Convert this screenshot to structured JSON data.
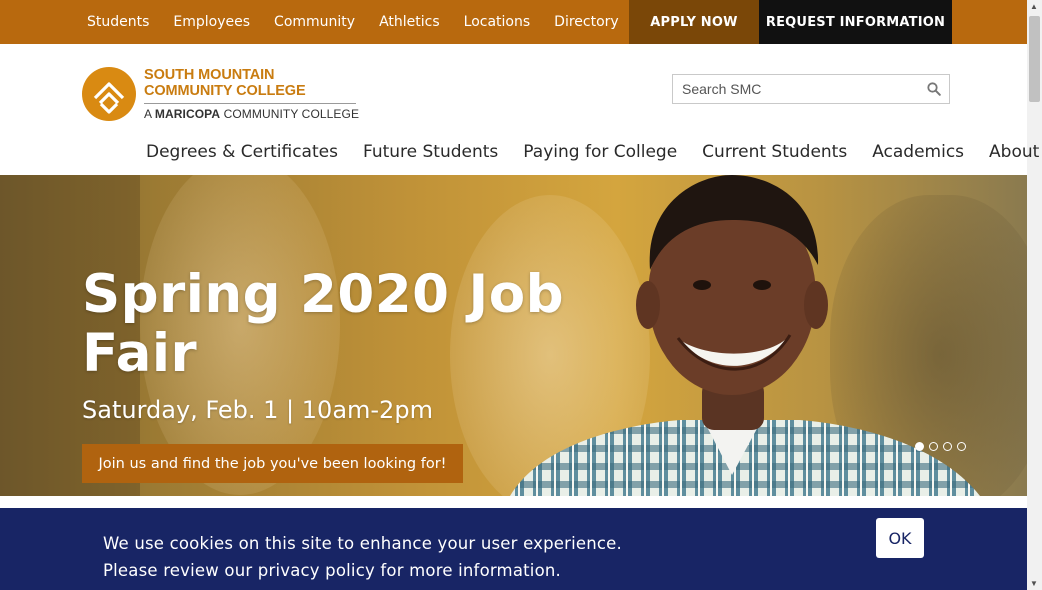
{
  "utility_nav": {
    "items": [
      "Students",
      "Employees",
      "Community",
      "Athletics",
      "Locations",
      "Directory"
    ],
    "apply_label": "APPLY NOW",
    "request_label": "REQUEST INFORMATION"
  },
  "logo": {
    "line1": "SOUTH MOUNTAIN",
    "line2": "COMMUNITY COLLEGE",
    "sub_prefix": "A",
    "sub_bold": "MARICOPA",
    "sub_rest": "COMMUNITY COLLEGE"
  },
  "search": {
    "placeholder": "Search SMC",
    "icon": "search-icon"
  },
  "main_nav": {
    "items": [
      "Degrees & Certificates",
      "Future Students",
      "Paying for College",
      "Current Students",
      "Academics",
      "About"
    ]
  },
  "hero": {
    "title": "Spring 2020 Job Fair",
    "date": "Saturday, Feb. 1 | 10am-2pm",
    "cta": "Join us and find the job you've been looking for!",
    "slide_count": 4,
    "active_slide": 1
  },
  "cookie": {
    "line1": "We use cookies on this site to enhance your user experience.",
    "line2": "Please review our privacy policy for more information.",
    "ok_label": "OK"
  },
  "colors": {
    "brand_orange": "#b8690e",
    "apply_bg": "#7a4708",
    "request_bg": "#111111",
    "cookie_bg": "#182565"
  }
}
